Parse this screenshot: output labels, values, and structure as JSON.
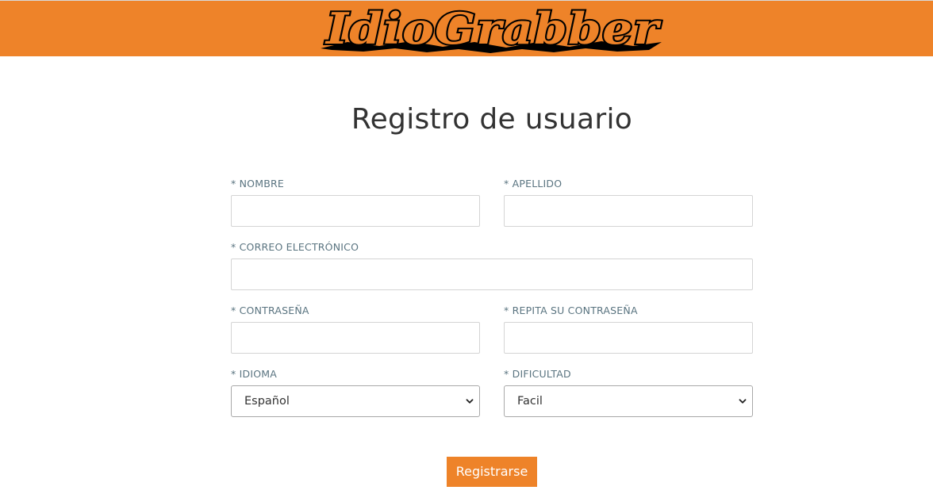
{
  "header": {
    "logo_text": "IdioGrabber",
    "brand_color": "#ee8329"
  },
  "page": {
    "title": "Registro de usuario"
  },
  "form": {
    "nombre": {
      "label": "* NOMBRE",
      "value": ""
    },
    "apellido": {
      "label": "* APELLIDO",
      "value": ""
    },
    "correo": {
      "label": "* CORREO ELECTRÓNICO",
      "value": ""
    },
    "contrasena": {
      "label": "* CONTRASEÑA",
      "value": ""
    },
    "repita": {
      "label": "* REPITA SU CONTRASEÑA",
      "value": ""
    },
    "idioma": {
      "label": "* IDIOMA",
      "selected": "Español"
    },
    "dificultad": {
      "label": "* DIFICULTAD",
      "selected": "Facil"
    },
    "submit_label": "Registrarse"
  }
}
